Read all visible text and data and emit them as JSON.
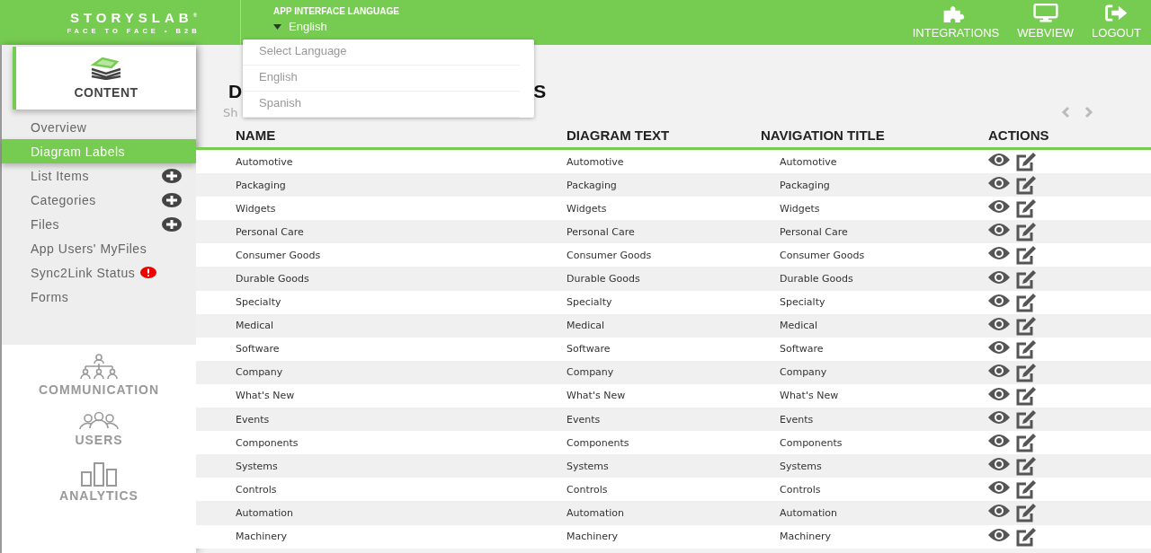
{
  "header": {
    "logo": {
      "name": "STORYSLAB",
      "mark": "®",
      "tagline": "FACE TO FACE • B2B"
    },
    "language": {
      "label": "APP INTERFACE LANGUAGE",
      "value": "English",
      "expanded": true,
      "options": [
        "Select Language",
        "English",
        "Spanish"
      ]
    },
    "actions": [
      {
        "kind": "integrations",
        "label": "INTEGRATIONS"
      },
      {
        "kind": "webview",
        "label": "WEBVIEW"
      },
      {
        "kind": "logout",
        "label": "LOGOUT"
      }
    ]
  },
  "sidebar": {
    "section": {
      "kind": "content",
      "label": "CONTENT"
    },
    "items": [
      {
        "label": "Overview",
        "kind": "plain",
        "selected": false
      },
      {
        "label": "Diagram Labels",
        "kind": "plain",
        "selected": true
      },
      {
        "label": "List Items",
        "kind": "add",
        "selected": false
      },
      {
        "label": "Categories",
        "kind": "add",
        "selected": false
      },
      {
        "label": "Files",
        "kind": "add",
        "selected": false
      },
      {
        "label": "App Users' MyFiles",
        "kind": "plain",
        "selected": false
      },
      {
        "label": "Sync2Link Status",
        "kind": "alert",
        "selected": false
      },
      {
        "label": "Forms",
        "kind": "plain",
        "selected": false
      }
    ],
    "sections": [
      {
        "kind": "communication",
        "label": "COMMUNICATION"
      },
      {
        "kind": "users",
        "label": "USERS"
      },
      {
        "kind": "analytics",
        "label": "ANALYTICS"
      }
    ]
  },
  "main": {
    "title_visible": [
      "D",
      "S"
    ],
    "subtitle_visible": [
      "Sh"
    ],
    "table": {
      "columns": [
        "NAME",
        "DIAGRAM TEXT",
        "NAVIGATION TITLE",
        "ACTIONS"
      ],
      "rows": [
        [
          "Automotive",
          "Automotive",
          "Automotive"
        ],
        [
          "Packaging",
          "Packaging",
          "Packaging"
        ],
        [
          "Widgets",
          "Widgets",
          "Widgets"
        ],
        [
          "Personal Care",
          "Personal Care",
          "Personal Care"
        ],
        [
          "Consumer Goods",
          "Consumer Goods",
          "Consumer Goods"
        ],
        [
          "Durable Goods",
          "Durable Goods",
          "Durable Goods"
        ],
        [
          "Specialty",
          "Specialty",
          "Specialty"
        ],
        [
          "Medical",
          "Medical",
          "Medical"
        ],
        [
          "Software",
          "Software",
          "Software"
        ],
        [
          "Company",
          "Company",
          "Company"
        ],
        [
          "What's New",
          "What's New",
          "What's New"
        ],
        [
          "Events",
          "Events",
          "Events"
        ],
        [
          "Components",
          "Components",
          "Components"
        ],
        [
          "Systems",
          "Systems",
          "Systems"
        ],
        [
          "Controls",
          "Controls",
          "Controls"
        ],
        [
          "Automation",
          "Automation",
          "Automation"
        ],
        [
          "Machinery",
          "Machinery",
          "Machinery"
        ]
      ]
    }
  }
}
